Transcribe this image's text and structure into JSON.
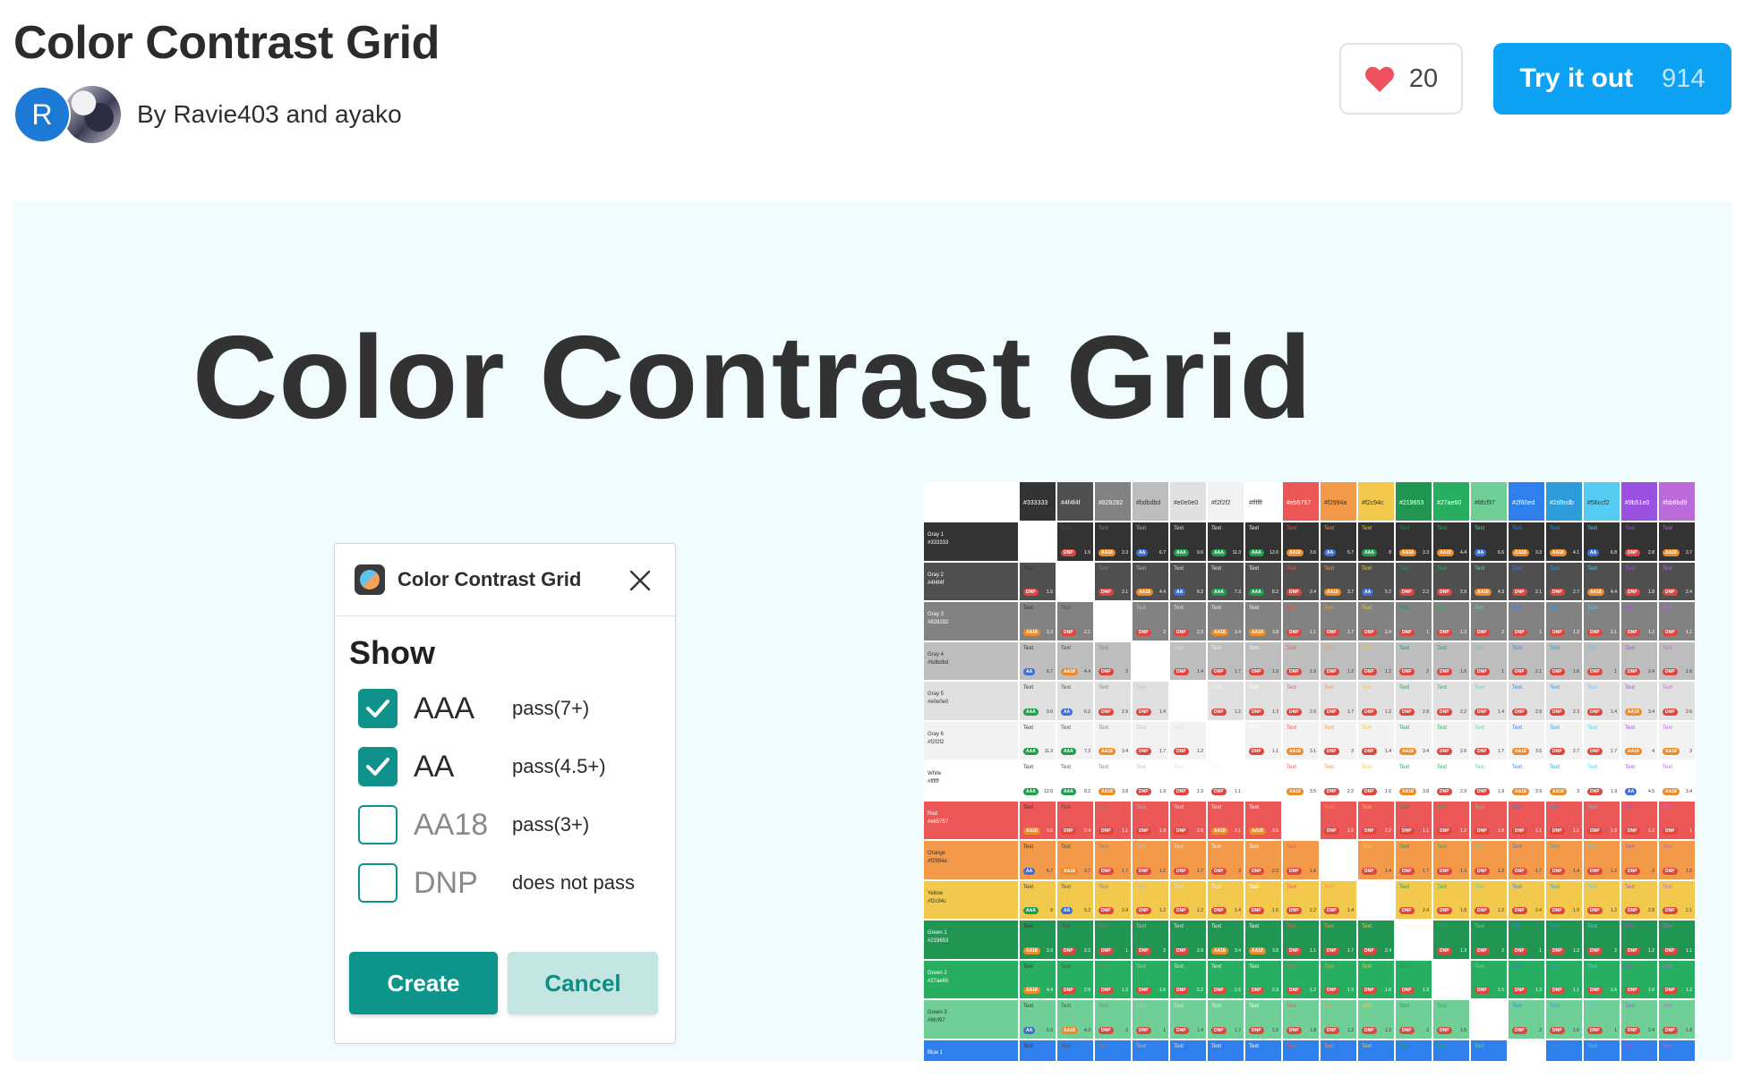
{
  "header": {
    "title": "Color Contrast Grid",
    "avatar_initial": "R",
    "byline": "By Ravie403 and ayako",
    "like_count": "20",
    "try_label": "Try it out",
    "try_count": "914",
    "accent_color": "#0ea2f5",
    "like_icon": "heart-icon"
  },
  "cover": {
    "title": "Color Contrast Grid",
    "background": "#f1fcfe"
  },
  "dialog": {
    "title": "Color Contrast Grid",
    "icon": "plugin-icon",
    "show_heading": "Show",
    "options": [
      {
        "name": "AAA",
        "desc": "pass(7+)",
        "checked": true
      },
      {
        "name": "AA",
        "desc": "pass(4.5+)",
        "checked": true
      },
      {
        "name": "AA18",
        "desc": "pass(3+)",
        "checked": false
      },
      {
        "name": "DNP",
        "desc": "does not pass",
        "checked": false
      }
    ],
    "create_label": "Create",
    "cancel_label": "Cancel",
    "accent_color": "#0d948b"
  },
  "grid": {
    "cell_text": "Text",
    "columns": [
      {
        "hex": "#333333",
        "color": "#333333"
      },
      {
        "hex": "#4f4f4f",
        "color": "#4f4f4f"
      },
      {
        "hex": "#828282",
        "color": "#828282"
      },
      {
        "hex": "#bdbdbd",
        "color": "#bdbdbd"
      },
      {
        "hex": "#e0e0e0",
        "color": "#e0e0e0"
      },
      {
        "hex": "#f2f2f2",
        "color": "#f2f2f2"
      },
      {
        "hex": "#ffffff",
        "color": "#ffffff"
      },
      {
        "hex": "#eb5757",
        "color": "#eb5757"
      },
      {
        "hex": "#f2994a",
        "color": "#f2994a"
      },
      {
        "hex": "#f2c94c",
        "color": "#f2c94c"
      },
      {
        "hex": "#219653",
        "color": "#219653"
      },
      {
        "hex": "#27ae60",
        "color": "#27ae60"
      },
      {
        "hex": "#6fcf97",
        "color": "#6fcf97"
      },
      {
        "hex": "#2f80ed",
        "color": "#2f80ed"
      },
      {
        "hex": "#2d9cdb",
        "color": "#2d9cdb"
      },
      {
        "hex": "#56ccf2",
        "color": "#56ccf2"
      },
      {
        "hex": "#9b51e0",
        "color": "#9b51e0"
      },
      {
        "hex": "#bb6bd9",
        "color": "#bb6bd9"
      }
    ],
    "rows": [
      {
        "name": "Gray 1",
        "hex": "#333333",
        "color": "#333333"
      },
      {
        "name": "Gray 2",
        "hex": "#4f4f4f",
        "color": "#4f4f4f"
      },
      {
        "name": "Gray 3",
        "hex": "#828282",
        "color": "#828282"
      },
      {
        "name": "Gray 4",
        "hex": "#bdbdbd",
        "color": "#bdbdbd"
      },
      {
        "name": "Gray 5",
        "hex": "#e0e0e0",
        "color": "#e0e0e0"
      },
      {
        "name": "Gray 6",
        "hex": "#f2f2f2",
        "color": "#f2f2f2"
      },
      {
        "name": "White",
        "hex": "#ffffff",
        "color": "#ffffff"
      },
      {
        "name": "Red",
        "hex": "#eb5757",
        "color": "#eb5757"
      },
      {
        "name": "Orange",
        "hex": "#f2994a",
        "color": "#f2994a"
      },
      {
        "name": "Yellow",
        "hex": "#f2c94c",
        "color": "#f2c94c"
      },
      {
        "name": "Green 1",
        "hex": "#219653",
        "color": "#219653"
      },
      {
        "name": "Green 2",
        "hex": "#27ae60",
        "color": "#27ae60"
      },
      {
        "name": "Green 3",
        "hex": "#6fcf97",
        "color": "#6fcf97"
      },
      {
        "name": "Blue 1",
        "hex": "",
        "color": "#2f80ed"
      }
    ],
    "badge_colors": {
      "AAA": "#1e9f4c",
      "AA": "#3b6fd9",
      "AA18": "#f08a24",
      "DNP": "#e0453e"
    }
  }
}
